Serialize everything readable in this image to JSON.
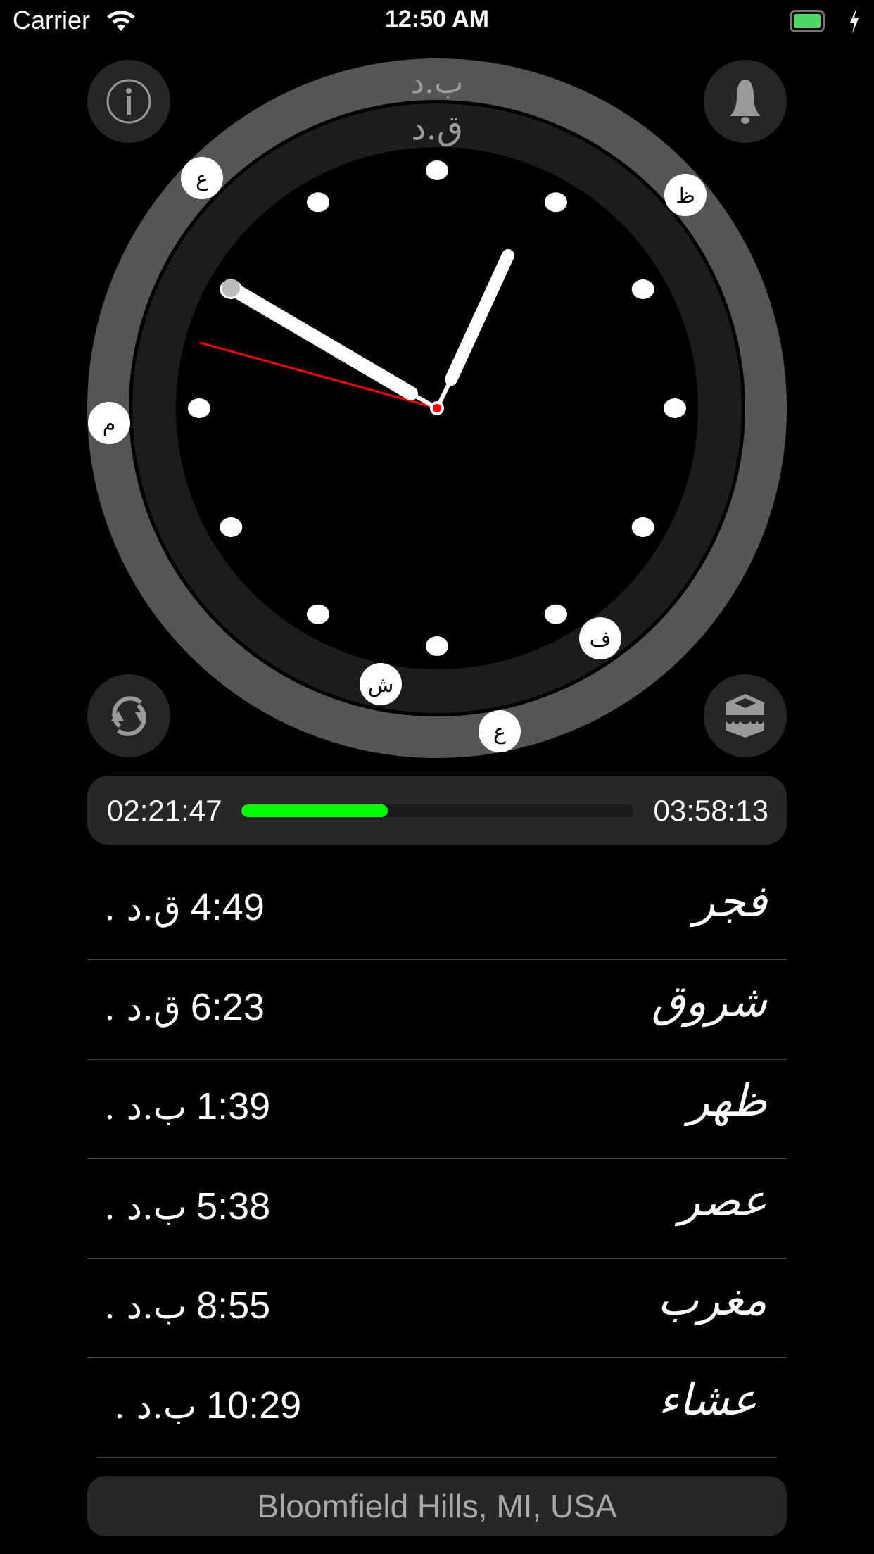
{
  "status_bar": {
    "carrier": "Carrier",
    "time": "12:50 AM",
    "battery_color": "#4cd964"
  },
  "clock": {
    "pm_label": "ب.د",
    "am_label": "ق.د",
    "markers": [
      {
        "label": "ع"
      },
      {
        "label": "ظ"
      },
      {
        "label": "م"
      },
      {
        "label": "ف"
      },
      {
        "label": "ش"
      },
      {
        "label": "ع"
      }
    ]
  },
  "buttons": {
    "info": "info-icon",
    "notifications": "bell-icon",
    "refresh": "refresh-icon",
    "qibla": "kaaba-icon"
  },
  "progress": {
    "elapsed": "02:21:47",
    "remaining": "03:58:13",
    "fraction": 0.373,
    "color": "#00ff00"
  },
  "prayers": [
    {
      "name": "فجر",
      "time": "4:49",
      "period": "ق.د ."
    },
    {
      "name": "شروق",
      "time": "6:23",
      "period": "ق.د ."
    },
    {
      "name": "ظهر",
      "time": "1:39",
      "period": "ب.د ."
    },
    {
      "name": "عصر",
      "time": "5:38",
      "period": "ب.د ."
    },
    {
      "name": "مغرب",
      "time": "8:55",
      "period": "ب.د ."
    },
    {
      "name": "عشاء",
      "time": "10:29",
      "period": "ب.د ."
    }
  ],
  "location": "Bloomfield Hills, MI, USA"
}
